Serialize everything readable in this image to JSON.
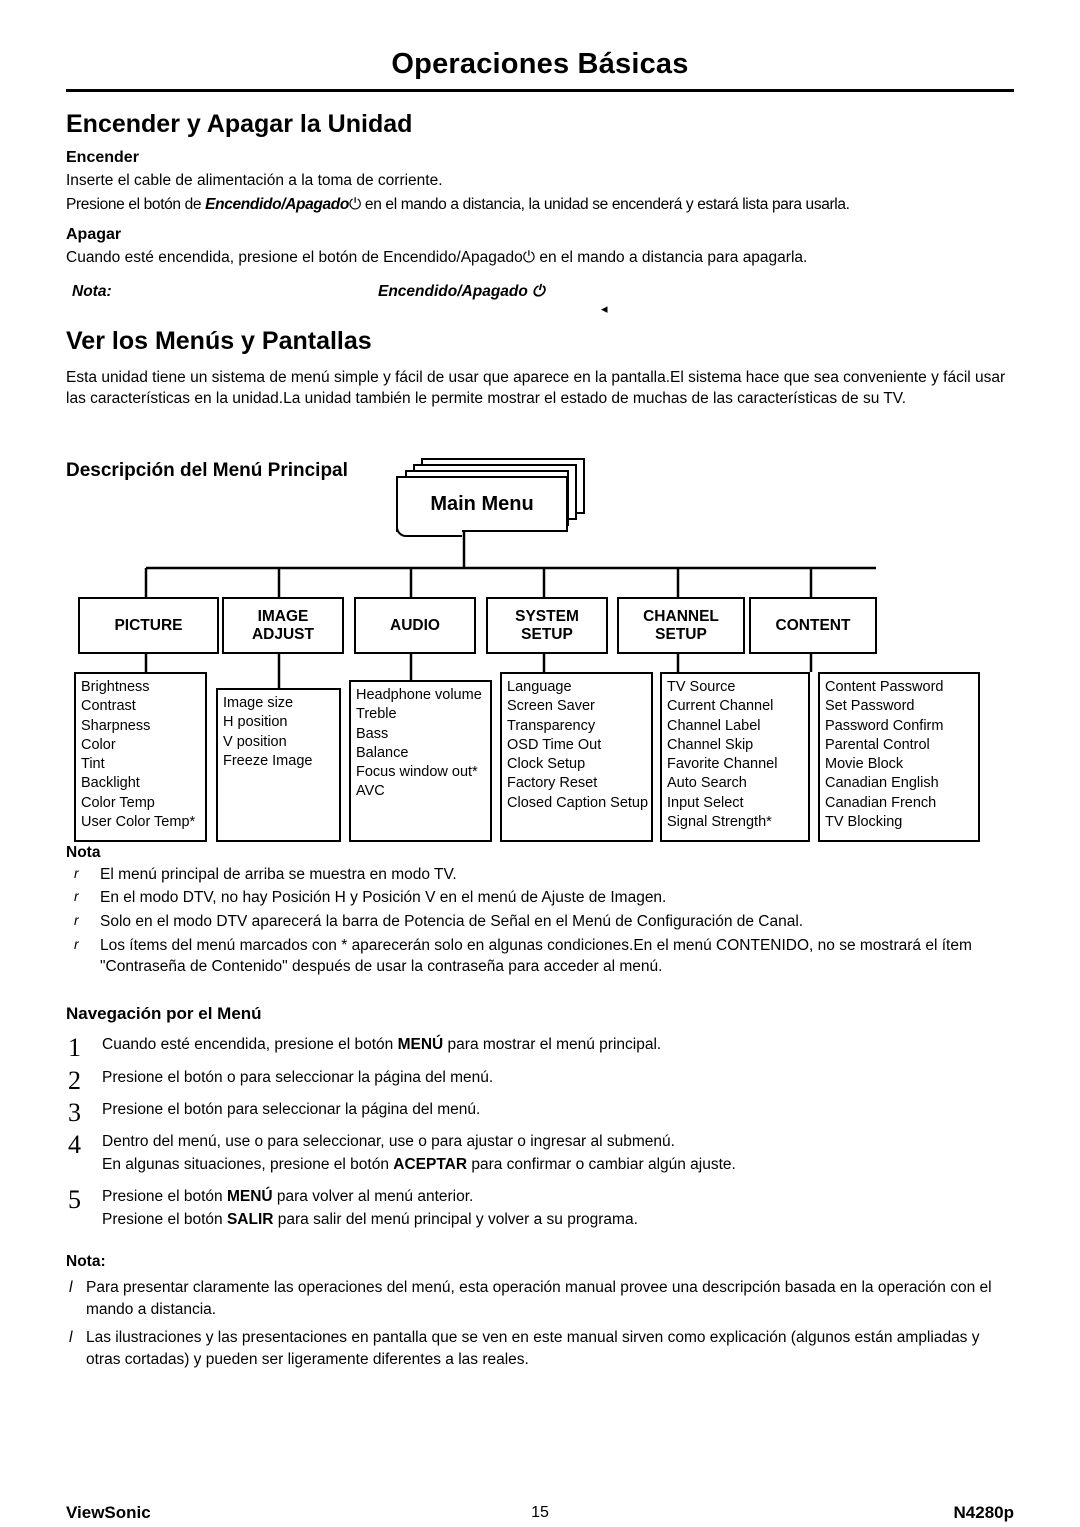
{
  "header": {
    "title": "Operaciones Básicas"
  },
  "section1": {
    "heading": "Encender y Apagar la Unidad",
    "sub1": "Encender",
    "p1": "Inserte el cable de alimentación a la toma de corriente.",
    "p2_a": "Presione el botón de ",
    "p2_b": "Encendido/Apagado",
    "p2_icon": "⏻",
    "p2_c": " en el mando a distancia, la unidad se encenderá y estará lista para usarla.",
    "sub2": "Apagar",
    "p3_a": "Cuando esté encendida, presione el botón de Encendido/Apagado",
    "p3_icon": "⏻",
    "p3_b": " en el mando a distancia  para apagarla.",
    "nota_label": "Nota:",
    "nota_target": "Encendido/Apagado",
    "nota_target_icon": "⏻",
    "pointer": "◂"
  },
  "section2": {
    "heading": "Ver los Menús y Pantallas",
    "p1": "Esta unidad tiene un sistema de menú simple y fácil de usar que aparece en la pantalla.El sistema hace que sea conveniente y fácil usar las características en la unidad.La unidad también le permite mostrar el estado de muchas de las características de su TV.",
    "diagram_title": "Descripción del Menú Principal"
  },
  "diagram": {
    "main_menu": "Main Menu",
    "categories": [
      {
        "label1": "PICTURE",
        "label2": ""
      },
      {
        "label1": "IMAGE",
        "label2": "ADJUST"
      },
      {
        "label1": "AUDIO",
        "label2": ""
      },
      {
        "label1": "SYSTEM",
        "label2": "SETUP"
      },
      {
        "label1": "CHANNEL",
        "label2": "SETUP"
      },
      {
        "label1": "CONTENT",
        "label2": ""
      }
    ],
    "columns": [
      {
        "items": [
          "Brightness",
          "Contrast",
          "Sharpness",
          "Color",
          "Tint",
          "Backlight",
          "Color Temp",
          "User Color Temp*"
        ]
      },
      {
        "items": [
          "Image size",
          "H position",
          "V position",
          "Freeze Image"
        ]
      },
      {
        "items": [
          "Headphone volume",
          "Treble",
          "Bass",
          "Balance",
          "Focus window out*",
          "AVC"
        ]
      },
      {
        "items": [
          "Language",
          "Screen Saver",
          "Transparency",
          "OSD Time Out",
          "Clock Setup",
          "Factory Reset",
          "Closed Caption Setup"
        ]
      },
      {
        "items": [
          "TV  Source",
          "Current  Channel",
          "Channel  Label",
          "Channel  Skip",
          "Favorite  Channel",
          "Auto  Search",
          "Input  Select",
          "Signal  Strength*"
        ]
      },
      {
        "items": [
          "Content  Password",
          "Set  Password",
          "Password  Confirm",
          "Parental  Control",
          "Movie  Block",
          "Canadian  English",
          "Canadian  French",
          "TV  Blocking"
        ]
      }
    ]
  },
  "notes1": {
    "heading": "Nota",
    "bullet": "r",
    "items": [
      "El menú principal de arriba se muestra en modo TV.",
      "En el modo DTV, no hay Posición H y Posición V en el menú de Ajuste de Imagen.",
      "Solo en el modo DTV aparecerá la barra de Potencia de Señal en el Menú de Configuración de Canal.",
      "Los ítems del menú marcados con * aparecerán solo en algunas condiciones.En el menú CONTENIDO, no se mostrará el ítem \"Contraseña de Contenido\" después de usar la contraseña para acceder al menú."
    ]
  },
  "navigation": {
    "heading": "Navegación por el Menú",
    "steps": [
      {
        "num": "1",
        "parts": [
          {
            "t": "Cuando esté encendida, presione el botón ",
            "b": false
          },
          {
            "t": "MENÚ",
            "b": true
          },
          {
            "t": " para mostrar el menú principal.",
            "b": false
          }
        ]
      },
      {
        "num": "2",
        "parts": [
          {
            "t": "Presione el botón    o    para seleccionar la página del menú.",
            "b": false
          }
        ]
      },
      {
        "num": "3",
        "parts": [
          {
            "t": "Presione el botón     para seleccionar la página del menú.",
            "b": false
          }
        ]
      },
      {
        "num": "4",
        "parts": [
          {
            "t": "Dentro del menú, use   o   para seleccionar, use   o   para ajustar o ingresar al submenú.",
            "b": false
          },
          {
            "t": "\n",
            "b": false
          },
          {
            "t": "En algunas situaciones, presione el botón ",
            "b": false
          },
          {
            "t": "ACEPTAR",
            "b": true
          },
          {
            "t": " para confirmar o cambiar algún ajuste.",
            "b": false
          }
        ]
      },
      {
        "num": "5",
        "parts": [
          {
            "t": "Presione el botón ",
            "b": false
          },
          {
            "t": "MENÚ",
            "b": true
          },
          {
            "t": " para volver al menú anterior.",
            "b": false
          },
          {
            "t": "\n",
            "b": false
          },
          {
            "t": "Presione el botón ",
            "b": false
          },
          {
            "t": "SALIR",
            "b": true
          },
          {
            "t": " para salir del menú principal y volver a su programa.",
            "b": false
          }
        ]
      }
    ]
  },
  "notes2": {
    "heading": "Nota:",
    "bullet": "l",
    "items": [
      "Para presentar claramente las operaciones del menú, esta operación manual provee una descripción basada en la operación con el mando a distancia.",
      "Las ilustraciones y las presentaciones en pantalla que se ven en este manual sirven como explicación (algunos están ampliadas y otras cortadas) y pueden ser ligeramente diferentes a las reales."
    ]
  },
  "footer": {
    "brand": "ViewSonic",
    "page": "15",
    "model": "N4280p"
  }
}
